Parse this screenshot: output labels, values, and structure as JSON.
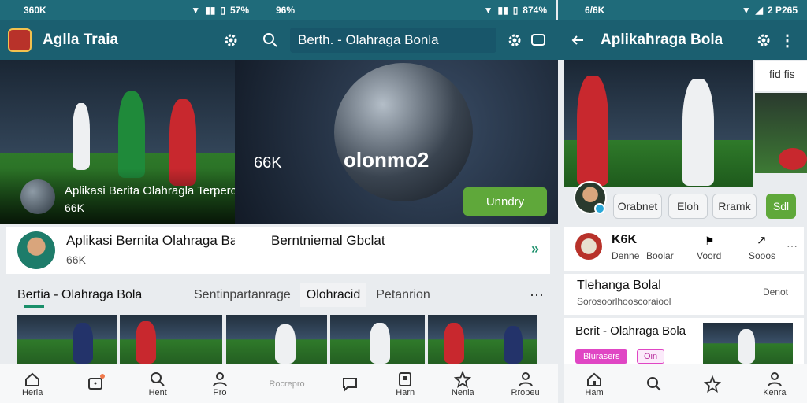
{
  "panel1": {
    "status": {
      "left": "360K",
      "right": "57%"
    },
    "title": "Aglla Traia",
    "hero": {
      "caption": "Aplikasi Berita Olahragla Terpercida",
      "meta": "66K"
    },
    "card": {
      "title": "Aplikasi Bernita Olahraga Balda",
      "meta": "66K"
    },
    "section_title": "Bertia - Olahraga Bola",
    "nav": [
      "Heria",
      "",
      "Hent",
      "Pro"
    ]
  },
  "panel2": {
    "status": {
      "left": "96%",
      "right": "874%"
    },
    "search_text": "Berth. - Olahraga Bonla",
    "hero": {
      "count": "66K",
      "brand": "olonmo2",
      "button": "Unndry"
    },
    "card_title_cont": "Berntniemal Gbclat",
    "tabs": [
      "Sentinpartanrage",
      "Olohracid",
      "Petanrion"
    ],
    "nav": [
      "Rocrepro",
      "",
      "Harn",
      "Nenia",
      "Rropeu"
    ]
  },
  "panel3": {
    "status": {
      "left": "6/6K",
      "right": "2 P265"
    },
    "title": "Aplikahraga Bola",
    "top_label": "fid fis",
    "chips": [
      "Orabnet",
      "Eloh",
      "Rramk",
      "Sdl"
    ],
    "stats": {
      "count": "K6K",
      "sub1": "Denne",
      "sub2": "Boolar",
      "action1": "Voord",
      "action2": "Sooos"
    },
    "item_title": "Tlehanga Bolal",
    "item_sub": "Sorosoorlhooscoraiool",
    "item_right": "Denot",
    "news_title": "Berit - Olahraga Bola",
    "badges": [
      "Blurasers",
      "Oin"
    ],
    "nav": [
      "Ham",
      "",
      "",
      "Kenra"
    ]
  },
  "colors": {
    "teal": "#1b5f70",
    "green_button": "#5fa83a",
    "pink_badge": "#e046c4"
  }
}
